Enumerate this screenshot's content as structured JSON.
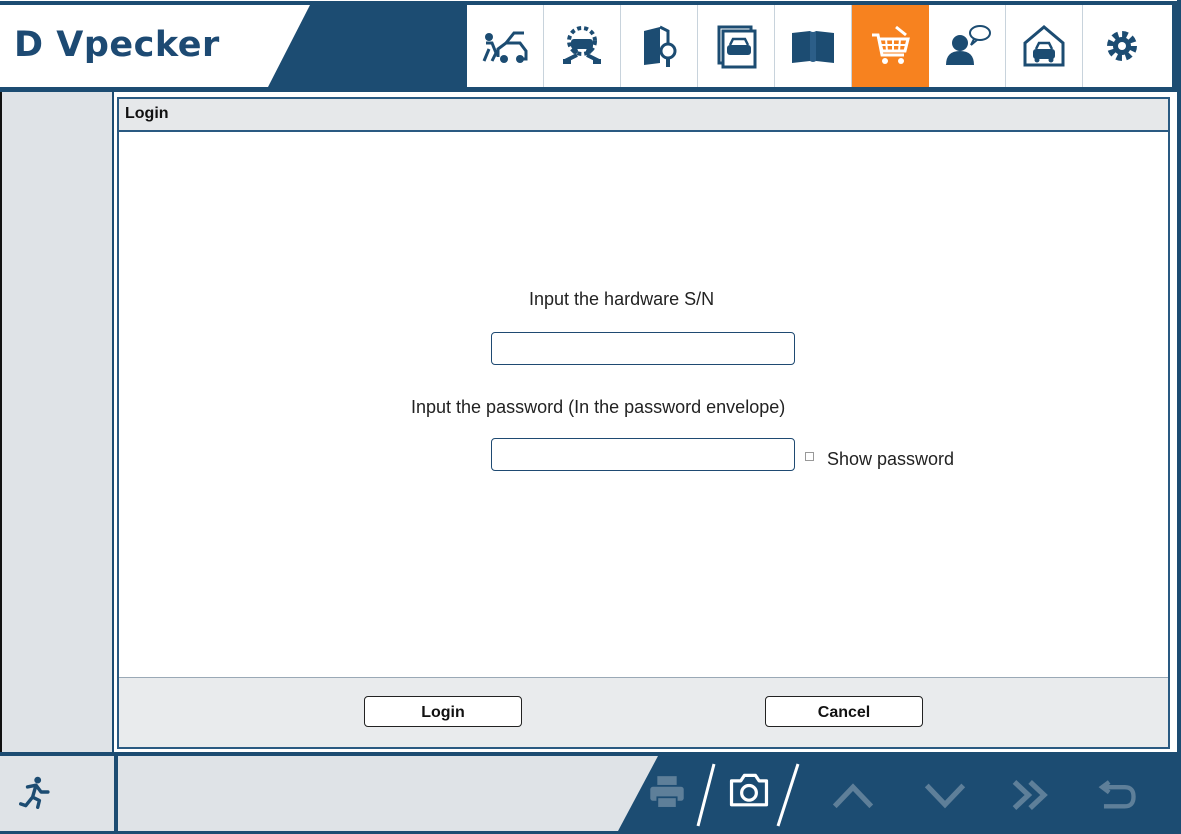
{
  "app": {
    "brand": "Vpecker",
    "logo_mark": "D"
  },
  "toolbar": {
    "items": [
      {
        "icon": "car-diagnosis-icon",
        "active": false
      },
      {
        "icon": "car-service-icon",
        "active": false
      },
      {
        "icon": "manual-search-icon",
        "active": false
      },
      {
        "icon": "vehicle-display-icon",
        "active": false
      },
      {
        "icon": "book-icon",
        "active": false
      },
      {
        "icon": "shopping-cart-icon",
        "active": true
      },
      {
        "icon": "user-feedback-icon",
        "active": false
      },
      {
        "icon": "garage-icon",
        "active": false
      },
      {
        "icon": "settings-gear-icon",
        "active": false
      }
    ],
    "active_color": "#f7821f"
  },
  "dialog": {
    "title": "Login",
    "sn_label": "Input the hardware S/N",
    "sn_value": "",
    "password_label": "Input the password (In the password envelope)",
    "password_value": "",
    "show_password_label": "Show password",
    "show_password_checked": false,
    "login_button": "Login",
    "cancel_button": "Cancel"
  },
  "bottom": {
    "icons": [
      "exit-run-icon",
      "print-icon",
      "camera-icon",
      "chevron-up-icon",
      "chevron-down-icon",
      "double-chevron-right-icon",
      "back-icon"
    ]
  },
  "colors": {
    "brand_blue": "#1c4c72",
    "accent_orange": "#f7821f"
  }
}
